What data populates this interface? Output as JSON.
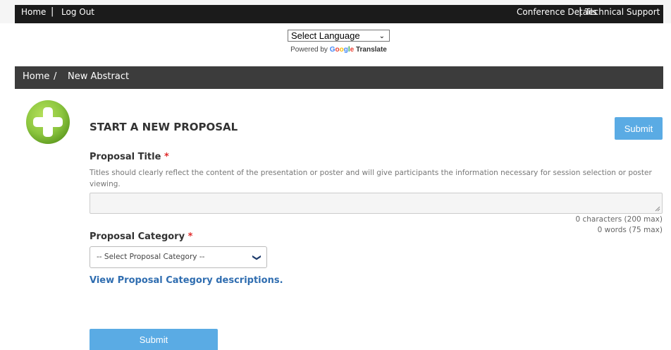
{
  "topbar": {
    "home": "Home",
    "logout": "Log Out",
    "conference_details": "Conference Details",
    "technical_support": "Technical Support",
    "separator": "|"
  },
  "translate": {
    "select_language": "Select Language",
    "powered_by": "Powered by",
    "google": "Google",
    "translate": "Translate"
  },
  "breadcrumb": {
    "home": "Home",
    "separator": "/",
    "current": "New Abstract"
  },
  "page": {
    "title": "START A NEW PROPOSAL",
    "submit_top": "Submit",
    "submit_bottom": "Submit",
    "plus_icon": "plus-icon",
    "accent_green": "#8cc63f",
    "button_color": "#5aabe4"
  },
  "proposal_title": {
    "label": "Proposal Title",
    "required_mark": "*",
    "help": "Titles should clearly reflect the content of the presentation or poster and will give participants the information necessary for session selection or poster viewing.",
    "value": "",
    "char_counter": "0 characters (200 max)",
    "word_counter": "0 words (75 max)"
  },
  "proposal_category": {
    "label": "Proposal Category",
    "required_mark": "*",
    "selected": "-- Select Proposal Category --",
    "view_link": "View Proposal Category descriptions."
  }
}
